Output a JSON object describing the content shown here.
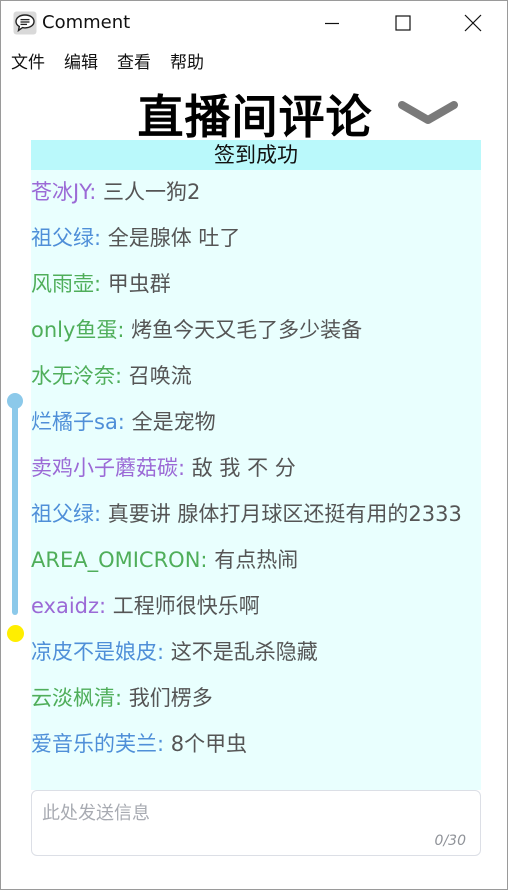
{
  "window": {
    "title": "Comment",
    "icon": "speech-bubble-icon"
  },
  "menu": [
    "文件",
    "编辑",
    "查看",
    "帮助"
  ],
  "heading": {
    "title": "直播间评论",
    "toggle_icon": "chevron-down-icon"
  },
  "banner": "签到成功",
  "comments": [
    {
      "user": "苍冰JY:",
      "text": " 三人一狗2",
      "color": "#9b6ad6"
    },
    {
      "user": "祖父绿:",
      "text": " 全是腺体 吐了",
      "color": "#4f8fd8"
    },
    {
      "user": "风雨壶:",
      "text": " 甲虫群",
      "color": "#4fae5a"
    },
    {
      "user": "only鱼蛋:",
      "text": " 烤鱼今天又毛了多少装备",
      "color": "#4fae5a"
    },
    {
      "user": "水无泠奈:",
      "text": " 召唤流",
      "color": "#4fae5a"
    },
    {
      "user": "烂橘子sa:",
      "text": " 全是宠物",
      "color": "#4f8fd8"
    },
    {
      "user": "卖鸡小子蘑菇碳:",
      "text": " 敌 我 不 分",
      "color": "#9b6ad6"
    },
    {
      "user": "祖父绿:",
      "text": " 真要讲 腺体打月球区还挺有用的2333",
      "color": "#4f8fd8"
    },
    {
      "user": "AREA_OMICRON:",
      "text": " 有点热闹",
      "color": "#4fae5a"
    },
    {
      "user": "exaidz:",
      "text": " 工程师很快乐啊",
      "color": "#9b6ad6"
    },
    {
      "user": "凉皮不是娘皮:",
      "text": " 这不是乱杀隐藏",
      "color": "#4f8fd8"
    },
    {
      "user": "云淡枫清:",
      "text": " 我们楞多",
      "color": "#4fae5a"
    },
    {
      "user": "爱音乐的芙兰:",
      "text": " 8个甲虫",
      "color": "#4f8fd8"
    }
  ],
  "input": {
    "placeholder": "此处发送信息",
    "value": "",
    "char_count": "0/30"
  },
  "colors": {
    "panel_bg": "#e9fffe",
    "banner_bg": "#baf9fb",
    "slider": "#8cc9ea",
    "marker": "#ffee00"
  }
}
